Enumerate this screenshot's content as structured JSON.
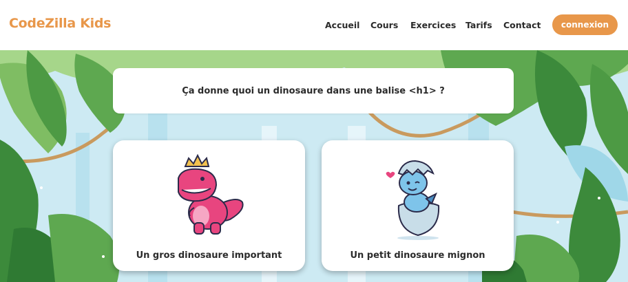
{
  "header": {
    "logo": "CodeZilla Kids",
    "nav": [
      "Accueil",
      "Cours",
      "Exercices",
      "Tarifs",
      "Contact"
    ],
    "login_label": "connexion"
  },
  "quiz": {
    "question": "Ça donne quoi un dinosaure dans une balise <h1> ?",
    "answers": [
      {
        "label": "Un gros dinosaure important",
        "icon": "crowned-pink-trex-icon"
      },
      {
        "label": "Un petit dinosaure mignon",
        "icon": "baby-blue-dino-in-egg-icon"
      }
    ]
  },
  "colors": {
    "brand": "#e8974a",
    "text": "#2b2b2b",
    "jungle_sky": "#cdeaf3",
    "leaf_dark": "#3c8a3b",
    "leaf_light": "#8fc97a",
    "vine": "#c99a5e"
  }
}
